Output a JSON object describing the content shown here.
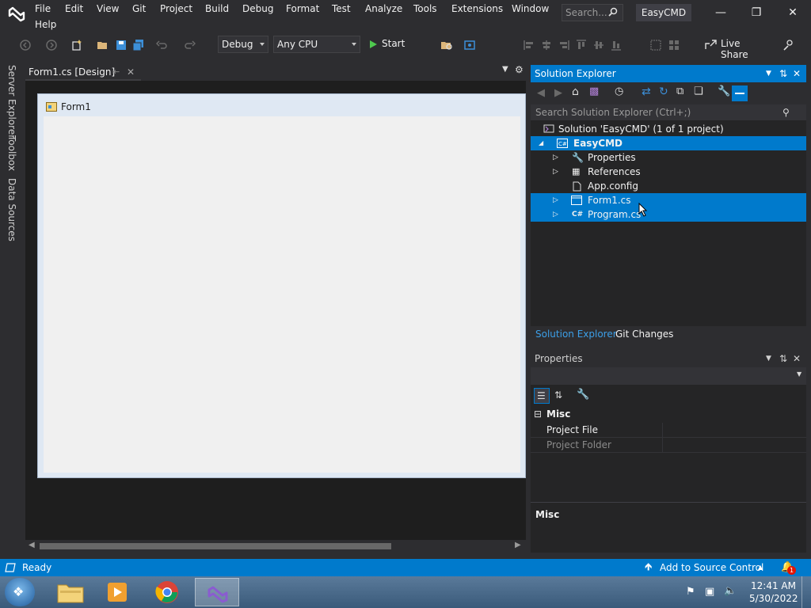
{
  "menu": {
    "items": [
      "File",
      "Edit",
      "View",
      "Git",
      "Project",
      "Build",
      "Debug",
      "Format",
      "Test",
      "Analyze",
      "Tools",
      "Extensions",
      "Window",
      "Help"
    ],
    "search_placeholder": "Search...",
    "app_title": "EasyCMD"
  },
  "toolbar": {
    "config": "Debug",
    "platform": "Any CPU",
    "start_label": "Start",
    "live_share": "Live Share"
  },
  "left_strip": {
    "tabs": [
      "Server Explorer",
      "Toolbox",
      "Data Sources"
    ]
  },
  "document": {
    "tab_label": "Form1.cs [Design]",
    "form_title": "Form1"
  },
  "solution_explorer": {
    "title": "Solution Explorer",
    "search_placeholder": "Search Solution Explorer (Ctrl+;)",
    "tree": [
      {
        "label": "Solution 'EasyCMD' (1 of 1 project)",
        "selected": false
      },
      {
        "label": "EasyCMD",
        "selected": true
      },
      {
        "label": "Properties",
        "selected": false
      },
      {
        "label": "References",
        "selected": false
      },
      {
        "label": "App.config",
        "selected": false
      },
      {
        "label": "Form1.cs",
        "selected": true
      },
      {
        "label": "Program.cs",
        "selected": true
      }
    ],
    "tabs": [
      "Solution Explorer",
      "Git Changes"
    ]
  },
  "properties": {
    "title": "Properties",
    "category": "Misc",
    "rows": [
      "Project File",
      "Project Folder"
    ],
    "footer_title": "Misc"
  },
  "status": {
    "ready": "Ready",
    "source_control": "Add to Source Control",
    "notification_count": "1"
  },
  "taskbar": {
    "time": "12:41 AM",
    "date": "5/30/2022"
  },
  "colors": {
    "accent": "#007acc",
    "background": "#2d2d30",
    "panel": "#252526",
    "designer": "#1e1e1e"
  }
}
